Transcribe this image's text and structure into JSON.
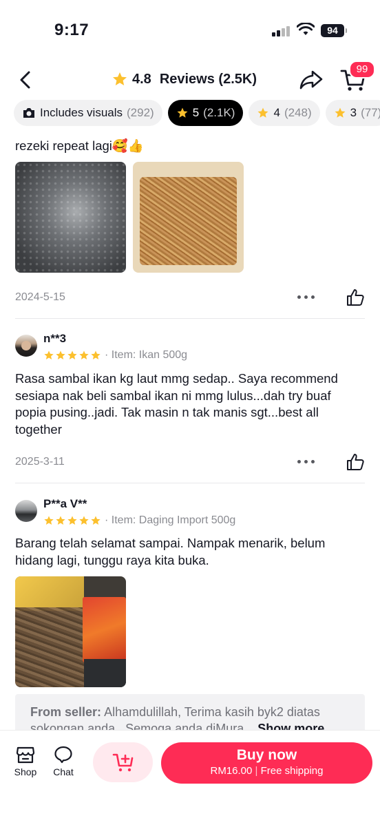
{
  "status_bar": {
    "time": "9:17",
    "battery": "94"
  },
  "header": {
    "rating": "4.8",
    "title": "Reviews (2.5K)",
    "cart_badge": "99"
  },
  "filters": [
    {
      "label": "Includes visuals",
      "count": "(292)"
    },
    {
      "label": "5",
      "count": "(2.1K)"
    },
    {
      "label": "4",
      "count": "(248)"
    },
    {
      "label": "3",
      "count": "(77)"
    }
  ],
  "reviews": [
    {
      "text_tail": "rezeki repeat lagi🥰👍",
      "date": "2024-5-15"
    },
    {
      "user": "n**3",
      "item": "Item: Ikan 500g",
      "text": "Rasa sambal ikan kg laut mmg sedap.. Saya recommend sesiapa nak beli sambal ikan ni mmg lulus...dah try buaf popia pusing..jadi. Tak masin n tak manis sgt...best all together",
      "date": "2025-3-11"
    },
    {
      "user": "P**a V**",
      "item": "Item: Daging Import 500g",
      "text": "Barang telah selamat sampai. Nampak menarik, belum hidang lagi, tunggu raya kita buka.",
      "seller_label": "From seller:",
      "seller_text": "Alhamdulillah, Terima kasih byk2 diatas sokongan anda.. Semoga anda diMura...",
      "show_more": "Show more"
    }
  ],
  "bottom_bar": {
    "shop": "Shop",
    "chat": "Chat",
    "buy_now": "Buy now",
    "price": "RM16.00",
    "shipping": "Free shipping"
  },
  "colors": {
    "accent": "#fe2c55",
    "star": "#fcc02e"
  }
}
